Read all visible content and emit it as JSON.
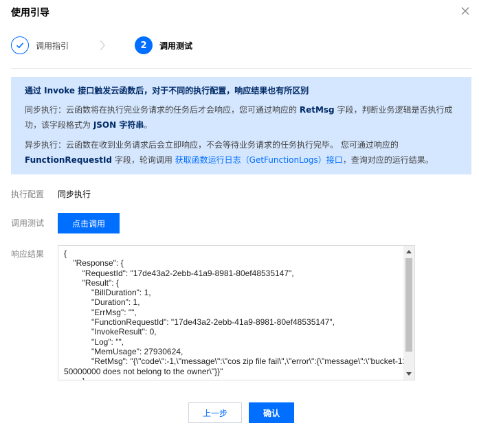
{
  "dialog": {
    "title": "使用引导"
  },
  "steps": [
    {
      "label": "调用指引",
      "status": "done"
    },
    {
      "number": "2",
      "label": "调用测试",
      "status": "active"
    }
  ],
  "notice": {
    "title": "通过 Invoke 接口触发云函数后，对于不同的执行配置，响应结果也有所区别",
    "sync_prefix": "同步执行：云函数将在执行完业务请求的任务后才会响应，您可通过响应的 ",
    "sync_key": "RetMsg",
    "sync_mid": " 字段，判断业务逻辑是否执行成功，该字段格式为 ",
    "sync_format": "JSON 字符串",
    "sync_suffix": "。",
    "async_prefix": "异步执行：云函数在收到业务请求后会立即响应，不会等待业务请求的任务执行完毕。 您可通过响应的 ",
    "async_key": "FunctionRequestId",
    "async_mid": " 字段，轮询调用 ",
    "async_link": "获取函数运行日志（GetFunctionLogs）接口",
    "async_suffix": "，查询对应的运行结果。"
  },
  "form": {
    "config_label": "执行配置",
    "config_value": "同步执行",
    "test_label": "调用测试",
    "invoke_button": "点击调用",
    "response_label": "响应结果",
    "response_text": "{\n    \"Response\": {\n        \"RequestId\": \"17de43a2-2ebb-41a9-8981-80ef48535147\",\n        \"Result\": {\n            \"BillDuration\": 1,\n            \"Duration\": 1,\n            \"ErrMsg\": \"\",\n            \"FunctionRequestId\": \"17de43a2-2ebb-41a9-8981-80ef48535147\",\n            \"InvokeResult\": 0,\n            \"Log\": \"\",\n            \"MemUsage\": 27930624,\n            \"RetMsg\": \"{\\\"code\\\":-1,\\\"message\\\":\\\"cos zip file fail\\\",\\\"error\\\":{\\\"message\\\":\\\"bucket-1250000000 does not belong to the owner\\\"}}\"\n        }\n    }\n}"
  },
  "footer": {
    "prev_button": "上一步",
    "ok_button": "确认"
  },
  "colors": {
    "primary": "#006eff",
    "notice_bg": "#d5e7ff",
    "notice_title": "#002a66"
  }
}
